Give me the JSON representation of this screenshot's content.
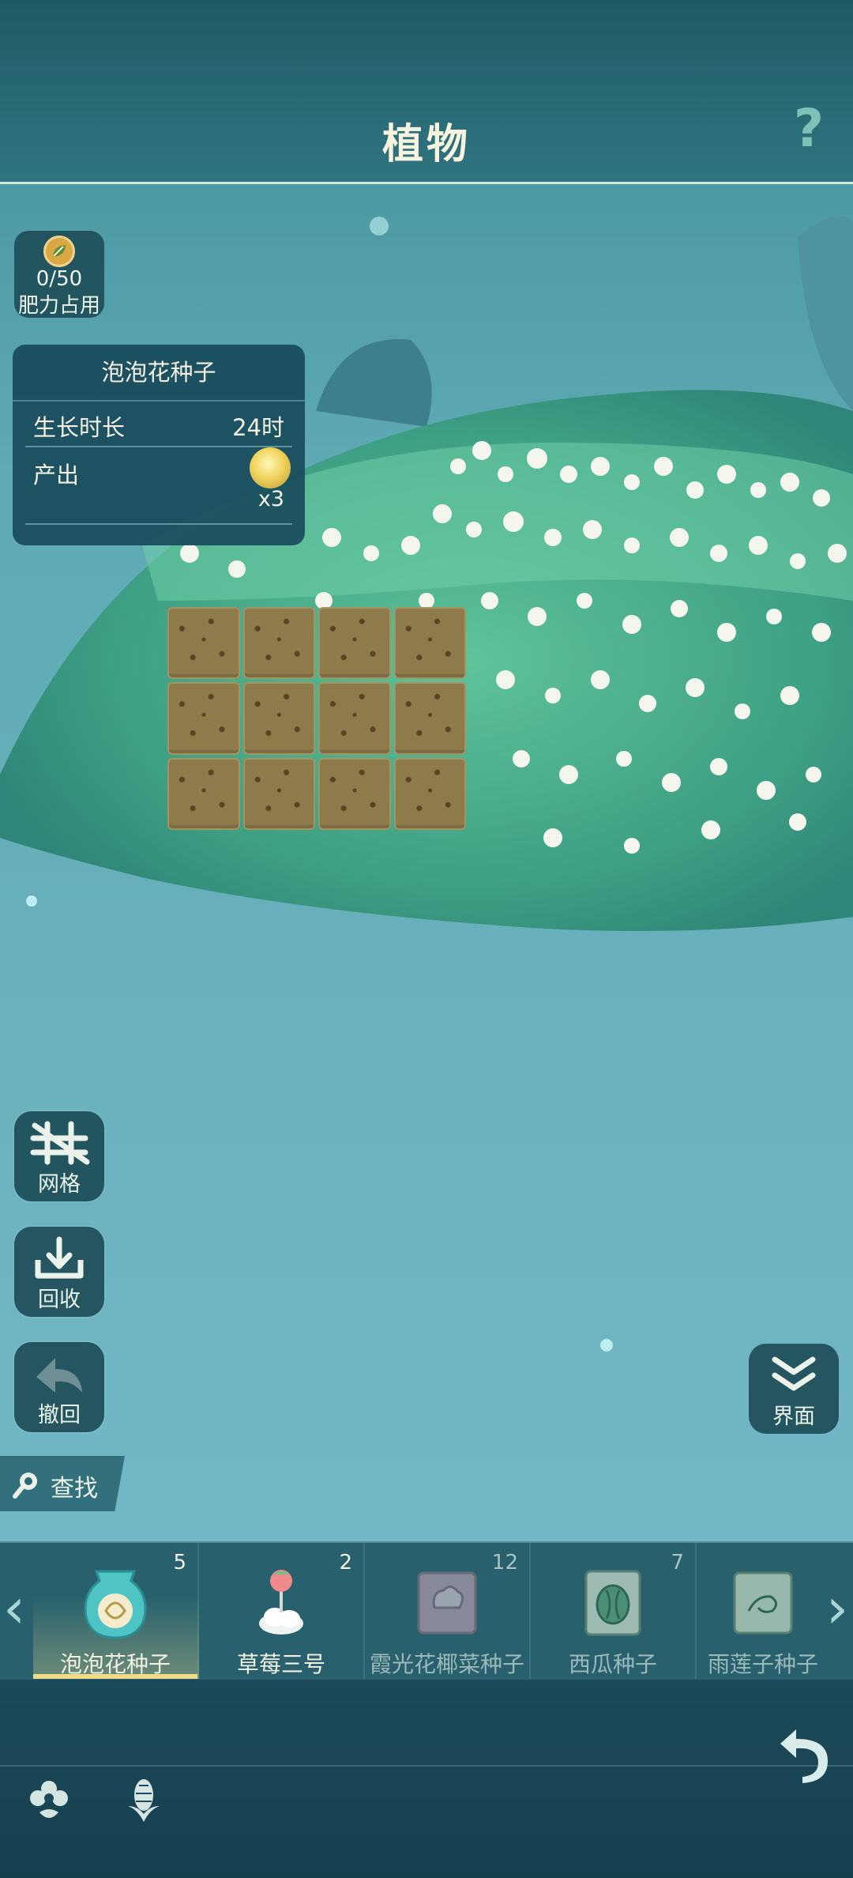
{
  "header": {
    "title": "植物",
    "help_icon": "question-mark-icon"
  },
  "fertilizer": {
    "value": "0/50",
    "label": "肥力占用",
    "icon": "leaf-coin-icon"
  },
  "info_panel": {
    "title": "泡泡花种子",
    "growth_label": "生长时长",
    "growth_value": "24时",
    "yield_label": "产出",
    "yield_qty": "x3",
    "yield_icon": "bubble-flower-icon"
  },
  "soil": {
    "rows": 3,
    "cols": 4
  },
  "tools": {
    "grid_label": "网格",
    "recycle_label": "回收",
    "undo_label": "撤回",
    "search_label": "查找",
    "interface_label": "界面"
  },
  "seeds": [
    {
      "name": "泡泡花种子",
      "count": "5",
      "selected": true,
      "icon": "seed-bag-icon"
    },
    {
      "name": "草莓三号",
      "count": "2",
      "selected": false,
      "icon": "strawberry-sprout-icon"
    },
    {
      "name": "霞光花椰菜种子",
      "count": "12",
      "selected": false,
      "icon": "cauliflower-seed-pack-icon"
    },
    {
      "name": "西瓜种子",
      "count": "7",
      "selected": false,
      "icon": "watermelon-seed-pack-icon"
    },
    {
      "name": "雨莲子种子",
      "count": "",
      "selected": false,
      "icon": "lotus-seed-pack-icon"
    }
  ],
  "colors": {
    "accent": "#f1dc8a",
    "panel": "#144658",
    "water": "#6ab5c9"
  }
}
